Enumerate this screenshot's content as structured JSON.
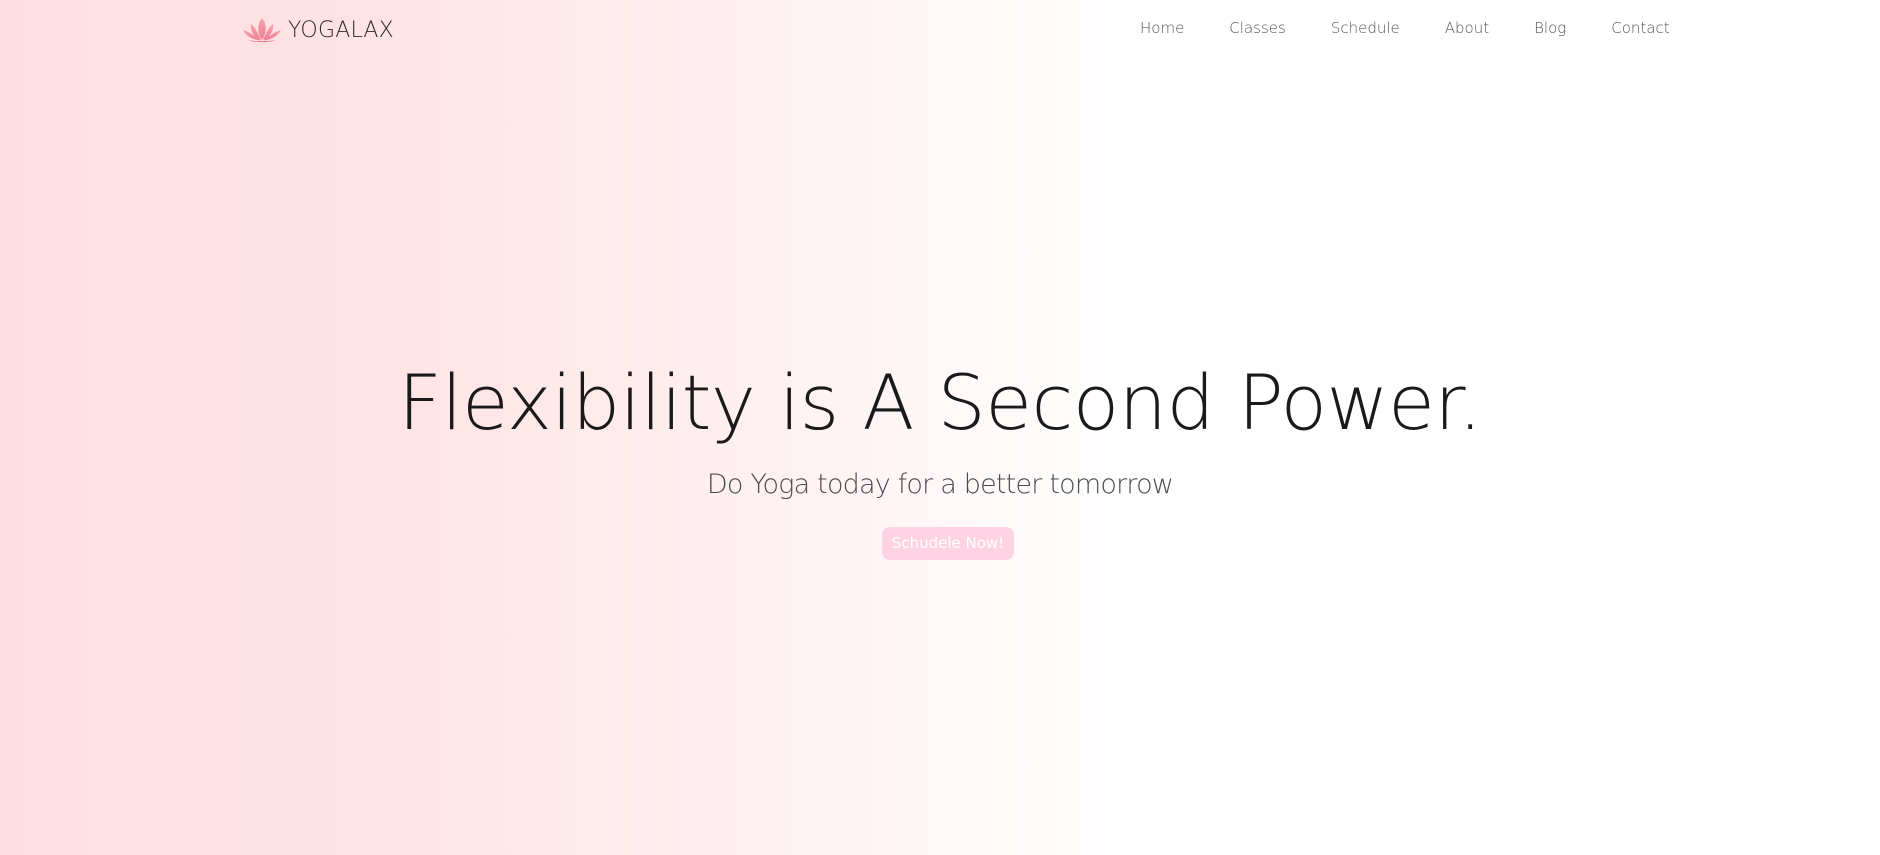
{
  "brand": {
    "name": "YOGALAX",
    "logo_icon": "lotus-icon",
    "logo_color": "#f48b9b"
  },
  "nav": {
    "items": [
      "Home",
      "Classes",
      "Schedule",
      "About",
      "Blog",
      "Contact"
    ]
  },
  "hero": {
    "title": "Flexibility is A Second Power.",
    "subtitle": "Do Yoga today for a better tomorrow",
    "cta_label": "Schudele Now!"
  },
  "colors": {
    "hero_gradient_start": "#ffdfe2",
    "hero_gradient_end": "#ffffff",
    "cta_background": "#ffd3e4",
    "cta_text": "#ffffff",
    "title_text": "#1a1a1a",
    "nav_text": "#555555"
  }
}
